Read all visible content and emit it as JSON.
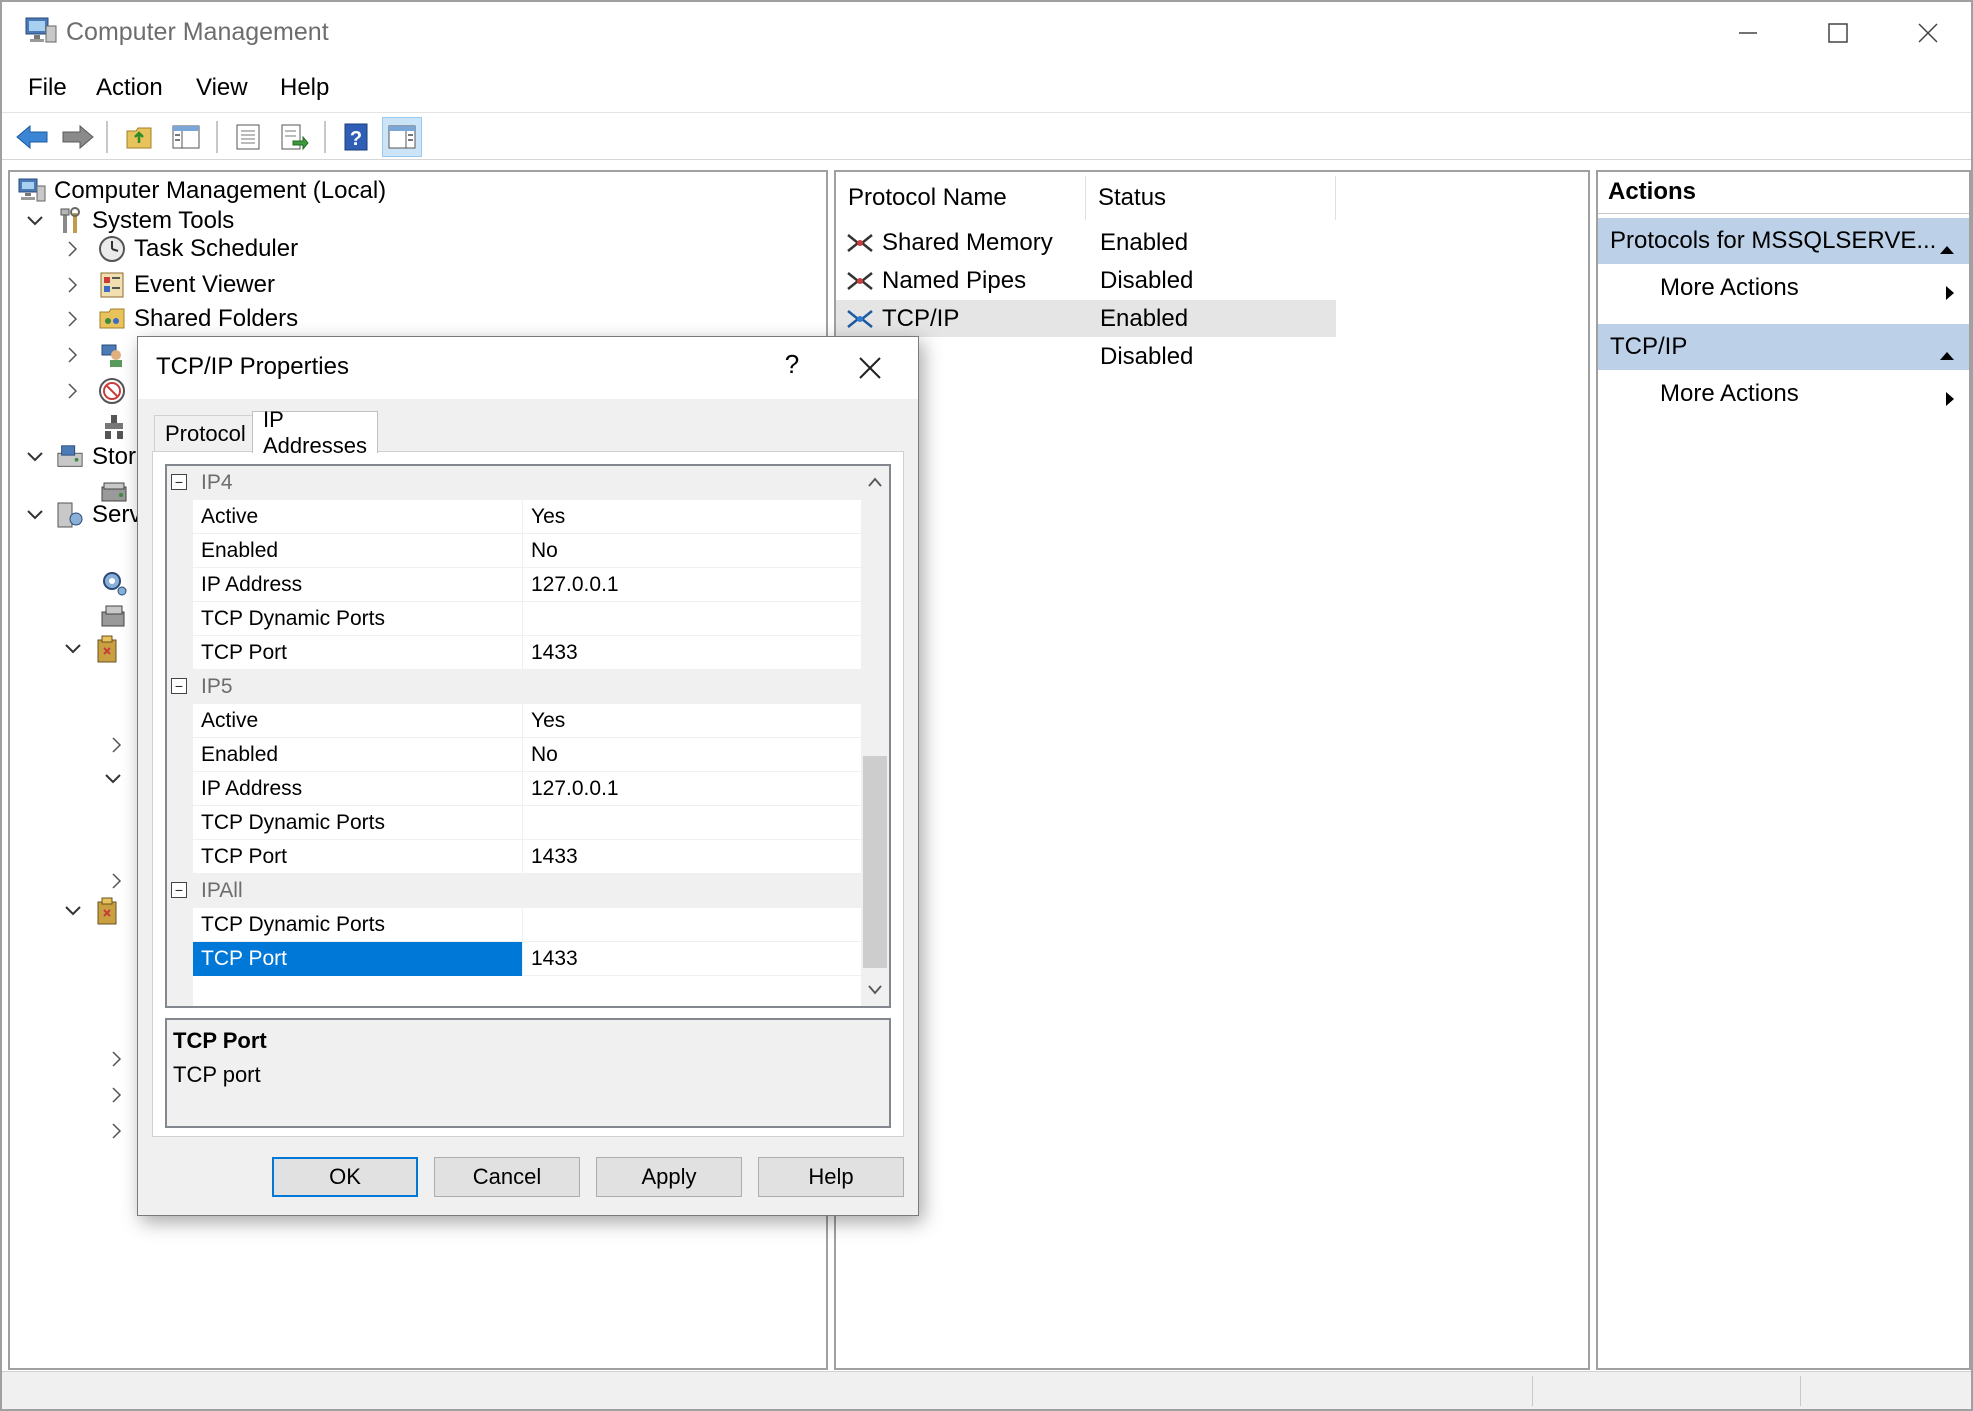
{
  "window": {
    "title": "Computer Management"
  },
  "menu": [
    "File",
    "Action",
    "View",
    "Help"
  ],
  "tree": {
    "root": "Computer Management (Local)",
    "system_tools": "System Tools",
    "task_scheduler": "Task Scheduler",
    "event_viewer": "Event Viewer",
    "shared_folders": "Shared Folders",
    "storage": "Stor",
    "services": "Serv"
  },
  "list": {
    "columns": [
      "Protocol Name",
      "Status"
    ],
    "rows": [
      {
        "name": "Shared Memory",
        "status": "Enabled"
      },
      {
        "name": "Named Pipes",
        "status": "Disabled"
      },
      {
        "name": "TCP/IP",
        "status": "Enabled"
      },
      {
        "name": "",
        "status": "Disabled"
      }
    ]
  },
  "actions": {
    "title": "Actions",
    "section1": "Protocols for MSSQLSERVE...",
    "section1_more": "More Actions",
    "section2": "TCP/IP",
    "section2_more": "More Actions"
  },
  "dialog": {
    "title": "TCP/IP Properties",
    "help_glyph": "?",
    "tabs": [
      "Protocol",
      "IP Addresses"
    ],
    "active_tab": "IP Addresses",
    "sections": [
      {
        "name": "IP4",
        "rows": [
          {
            "key": "Active",
            "value": "Yes"
          },
          {
            "key": "Enabled",
            "value": "No"
          },
          {
            "key": "IP Address",
            "value": "127.0.0.1"
          },
          {
            "key": "TCP Dynamic Ports",
            "value": ""
          },
          {
            "key": "TCP Port",
            "value": "1433"
          }
        ]
      },
      {
        "name": "IP5",
        "rows": [
          {
            "key": "Active",
            "value": "Yes"
          },
          {
            "key": "Enabled",
            "value": "No"
          },
          {
            "key": "IP Address",
            "value": "127.0.0.1"
          },
          {
            "key": "TCP Dynamic Ports",
            "value": ""
          },
          {
            "key": "TCP Port",
            "value": "1433"
          }
        ]
      },
      {
        "name": "IPAll",
        "rows": [
          {
            "key": "TCP Dynamic Ports",
            "value": ""
          },
          {
            "key": "TCP Port",
            "value": "1433"
          }
        ]
      }
    ],
    "description_title": "TCP Port",
    "description_text": "TCP port",
    "buttons": {
      "ok": "OK",
      "cancel": "Cancel",
      "apply": "Apply",
      "help": "Help"
    }
  },
  "colors": {
    "selection": "#0078d7",
    "actions_header": "#bcd0e8",
    "dialog_bg": "#f0f0f0"
  }
}
